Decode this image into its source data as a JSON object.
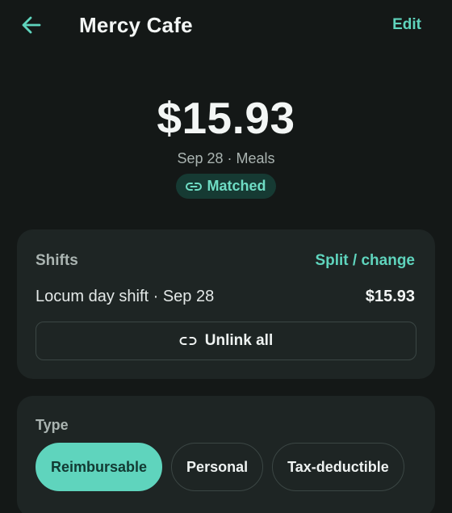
{
  "header": {
    "title": "Mercy Cafe",
    "edit_label": "Edit"
  },
  "transaction": {
    "amount": "$15.93",
    "meta": "Sep 28 · Meals",
    "status_badge": "Matched"
  },
  "shifts_card": {
    "title": "Shifts",
    "action_label": "Split / change",
    "shift": {
      "name": "Locum day shift · Sep 28",
      "amount": "$15.93"
    },
    "unlink_label": "Unlink all"
  },
  "type_card": {
    "title": "Type",
    "options": [
      "Reimbursable",
      "Personal",
      "Tax-deductible"
    ],
    "selected": "Reimbursable"
  },
  "colors": {
    "accent": "#5fd4bd",
    "background": "#141817",
    "card": "#1e2524"
  },
  "icons": {
    "back": "arrow-left-icon",
    "badge": "link-icon",
    "unlink": "unlink-icon"
  }
}
